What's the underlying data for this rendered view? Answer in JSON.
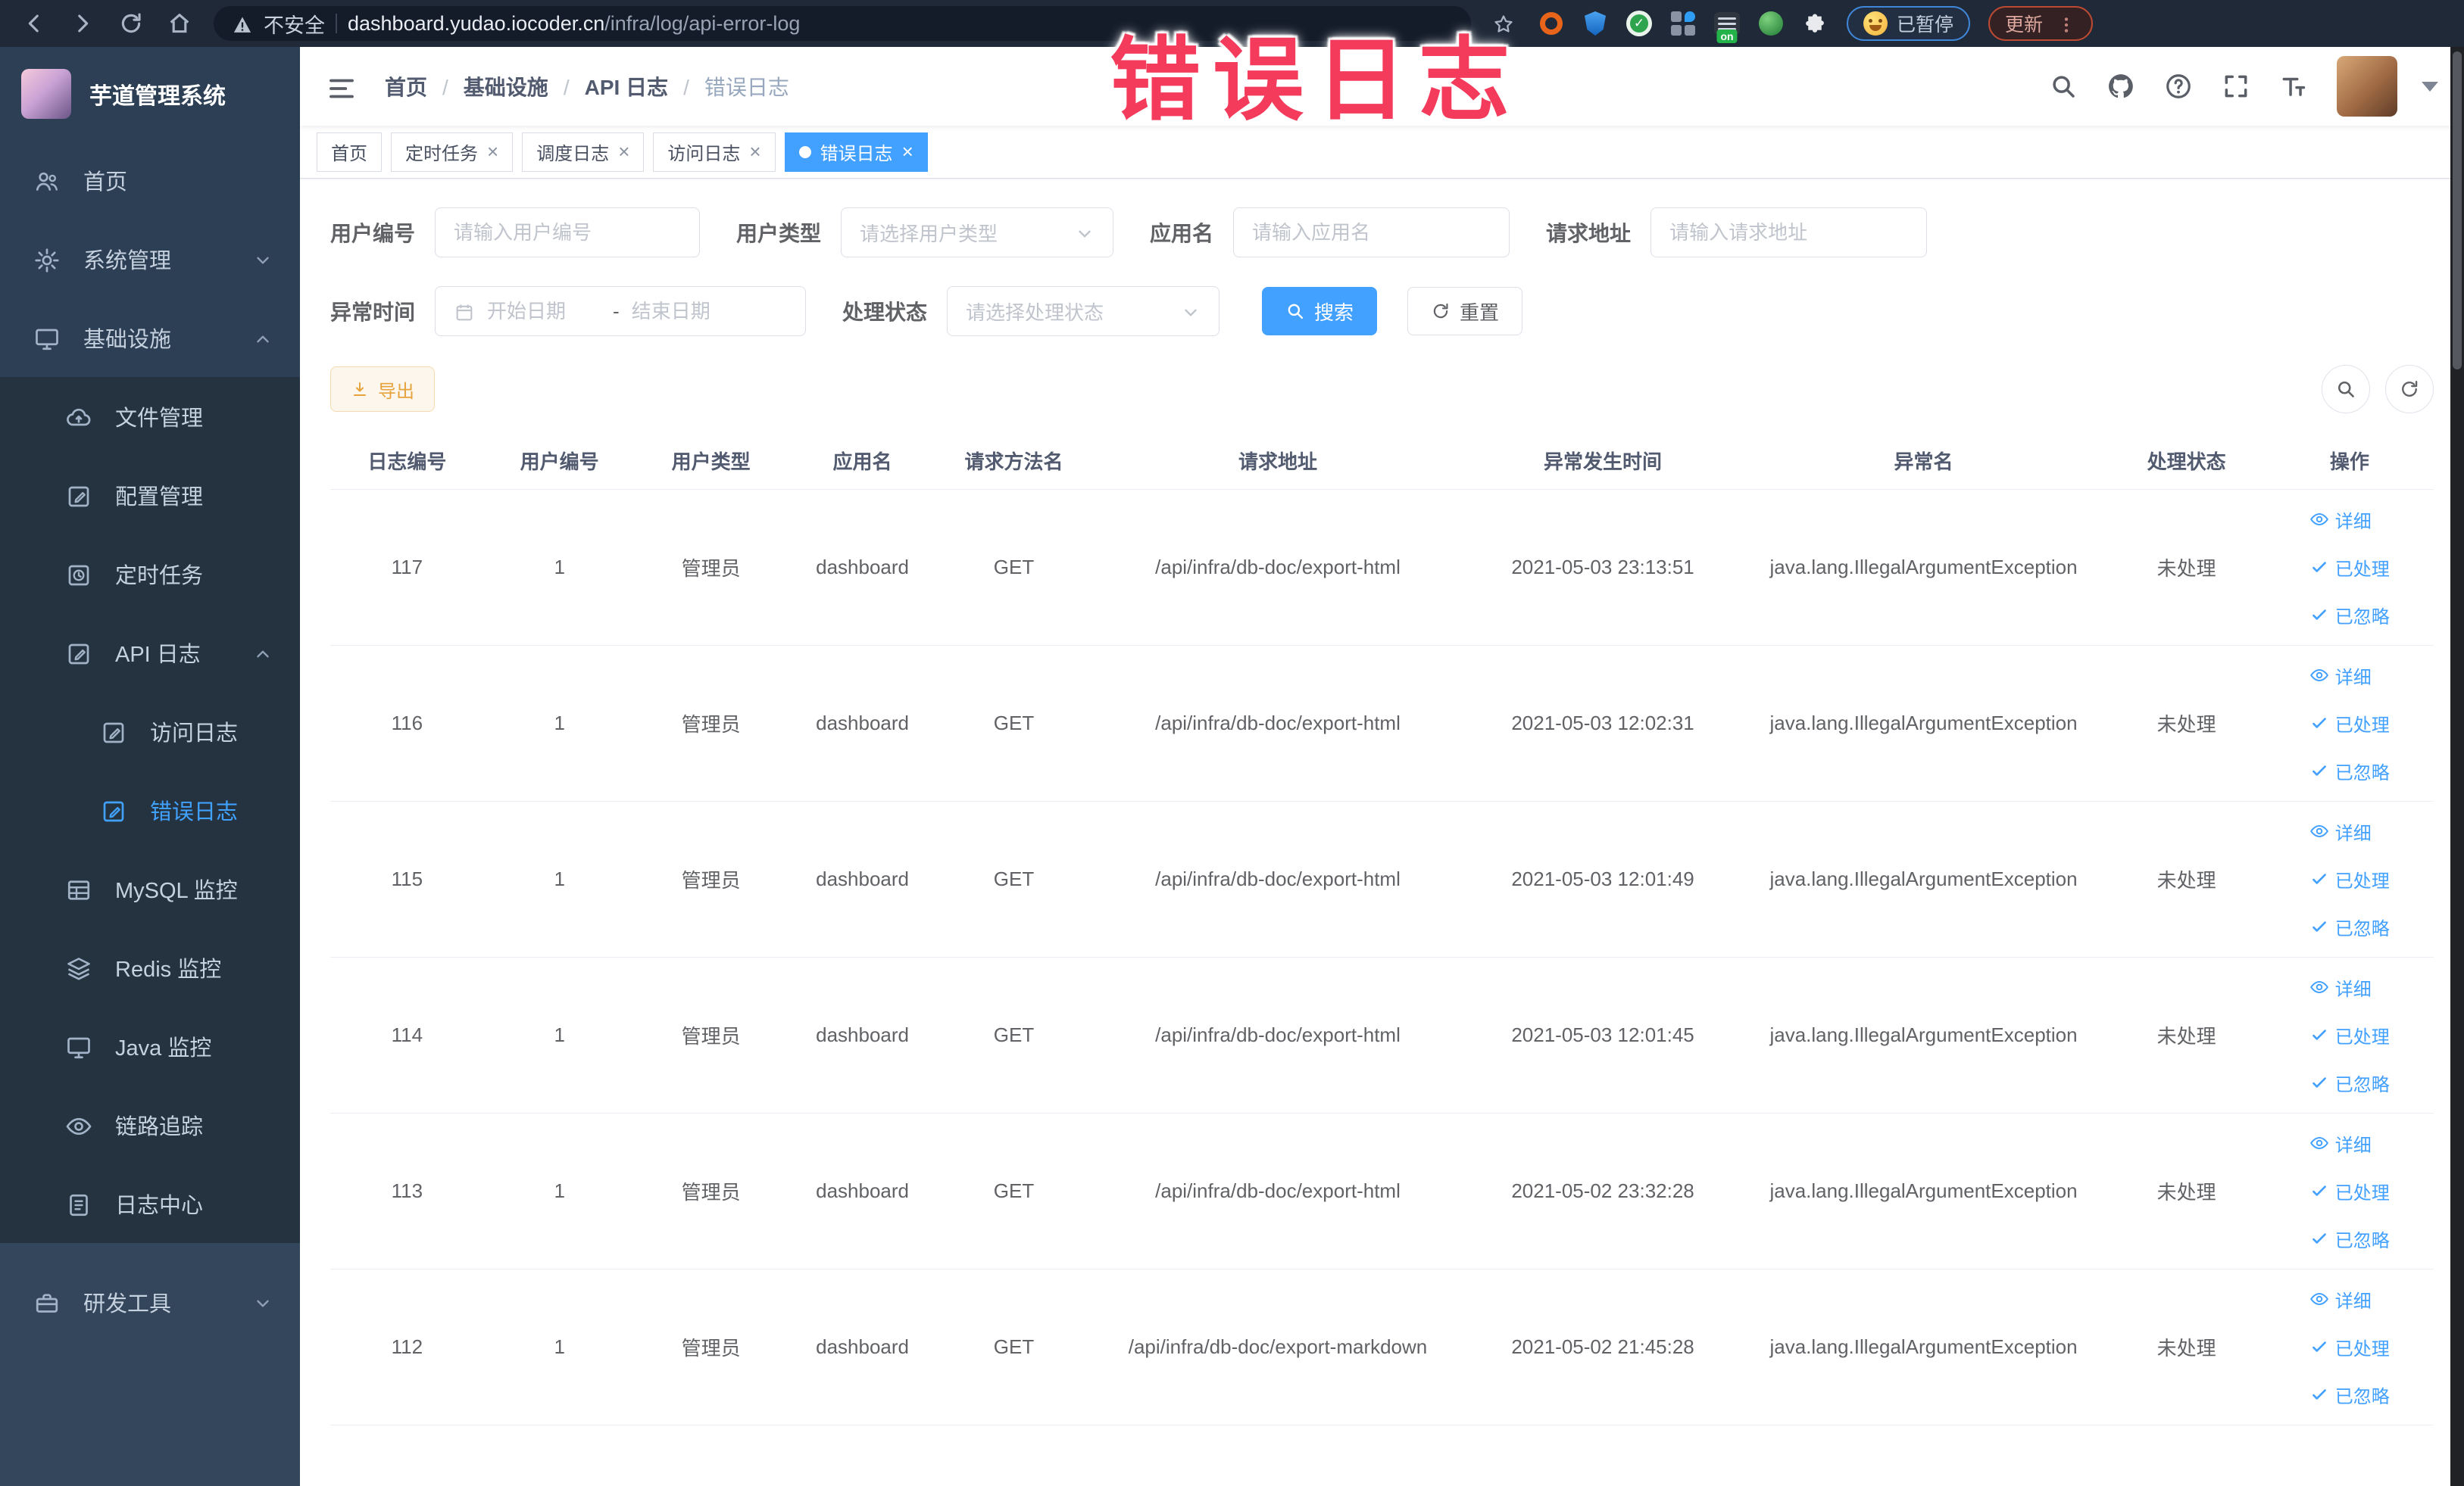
{
  "browser": {
    "security_label": "不安全",
    "url_host": "dashboard.yudao.iocoder.cn",
    "url_path": "/infra/log/api-error-log",
    "paused_badge": "已暂停",
    "update_badge": "更新",
    "extension_badge": "on"
  },
  "overlay": {
    "text": "错误日志"
  },
  "sidebar": {
    "title": "芋道管理系统",
    "items": [
      {
        "label": "首页"
      },
      {
        "label": "系统管理"
      },
      {
        "label": "基础设施"
      },
      {
        "label": "文件管理"
      },
      {
        "label": "配置管理"
      },
      {
        "label": "定时任务"
      },
      {
        "label": "API 日志"
      },
      {
        "label": "访问日志"
      },
      {
        "label": "错误日志"
      },
      {
        "label": "MySQL 监控"
      },
      {
        "label": "Redis 监控"
      },
      {
        "label": "Java 监控"
      },
      {
        "label": "链路追踪"
      },
      {
        "label": "日志中心"
      },
      {
        "label": "研发工具"
      }
    ]
  },
  "breadcrumb": {
    "items": [
      "首页",
      "基础设施",
      "API 日志",
      "错误日志"
    ]
  },
  "tabs": [
    {
      "label": "首页"
    },
    {
      "label": "定时任务"
    },
    {
      "label": "调度日志"
    },
    {
      "label": "访问日志"
    },
    {
      "label": "错误日志"
    }
  ],
  "filters": {
    "user_id": {
      "label": "用户编号",
      "placeholder": "请输入用户编号"
    },
    "user_type": {
      "label": "用户类型",
      "placeholder": "请选择用户类型"
    },
    "app_name": {
      "label": "应用名",
      "placeholder": "请输入应用名"
    },
    "request_url": {
      "label": "请求地址",
      "placeholder": "请输入请求地址"
    },
    "exception_time": {
      "label": "异常时间",
      "start_placeholder": "开始日期",
      "separator": "-",
      "end_placeholder": "结束日期"
    },
    "process_status": {
      "label": "处理状态",
      "placeholder": "请选择处理状态"
    },
    "search_label": "搜索",
    "reset_label": "重置"
  },
  "toolbar": {
    "export_label": "导出"
  },
  "table": {
    "headers": [
      "日志编号",
      "用户编号",
      "用户类型",
      "应用名",
      "请求方法名",
      "请求地址",
      "异常发生时间",
      "异常名",
      "处理状态",
      "操作"
    ],
    "actions": [
      "详细",
      "已处理",
      "已忽略"
    ],
    "rows": [
      {
        "id": "117",
        "user_id": "1",
        "user_type": "管理员",
        "app": "dashboard",
        "method": "GET",
        "url": "/api/infra/db-doc/export-html",
        "time": "2021-05-03 23:13:51",
        "exception": "java.lang.IllegalArgumentException",
        "status": "未处理"
      },
      {
        "id": "116",
        "user_id": "1",
        "user_type": "管理员",
        "app": "dashboard",
        "method": "GET",
        "url": "/api/infra/db-doc/export-html",
        "time": "2021-05-03 12:02:31",
        "exception": "java.lang.IllegalArgumentException",
        "status": "未处理"
      },
      {
        "id": "115",
        "user_id": "1",
        "user_type": "管理员",
        "app": "dashboard",
        "method": "GET",
        "url": "/api/infra/db-doc/export-html",
        "time": "2021-05-03 12:01:49",
        "exception": "java.lang.IllegalArgumentException",
        "status": "未处理"
      },
      {
        "id": "114",
        "user_id": "1",
        "user_type": "管理员",
        "app": "dashboard",
        "method": "GET",
        "url": "/api/infra/db-doc/export-html",
        "time": "2021-05-03 12:01:45",
        "exception": "java.lang.IllegalArgumentException",
        "status": "未处理"
      },
      {
        "id": "113",
        "user_id": "1",
        "user_type": "管理员",
        "app": "dashboard",
        "method": "GET",
        "url": "/api/infra/db-doc/export-html",
        "time": "2021-05-02 23:32:28",
        "exception": "java.lang.IllegalArgumentException",
        "status": "未处理"
      },
      {
        "id": "112",
        "user_id": "1",
        "user_type": "管理员",
        "app": "dashboard",
        "method": "GET",
        "url": "/api/infra/db-doc/export-markdown",
        "time": "2021-05-02 21:45:28",
        "exception": "java.lang.IllegalArgumentException",
        "status": "未处理"
      }
    ]
  },
  "colors": {
    "accent": "#409EFF",
    "warning": "#E6A23C",
    "overlay_red": "#F43B5C",
    "sidebar_bg": "#2D3F54"
  }
}
